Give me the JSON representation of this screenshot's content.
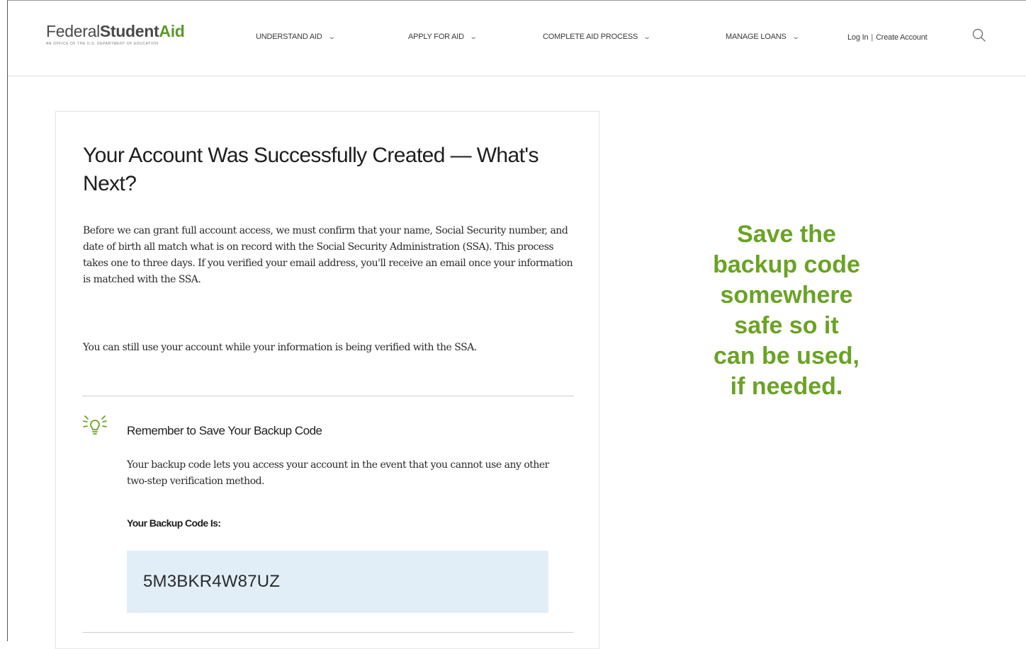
{
  "header": {
    "logo": {
      "part1": "Federal",
      "part2": "Student",
      "part3": "Aid",
      "tagline": "AN OFFICE of the U.S. DEPARTMENT of EDUCATION"
    },
    "nav": [
      {
        "label": "UNDERSTAND AID"
      },
      {
        "label": "APPLY FOR AID"
      },
      {
        "label": "COMPLETE AID PROCESS"
      },
      {
        "label": "MANAGE LOANS"
      }
    ],
    "login_label": "Log In",
    "separator": "|",
    "create_account_label": "Create Account",
    "search_icon": "search-icon"
  },
  "card": {
    "title": "Your Account Was Successfully Created — What's Next?",
    "paragraph1": "Before we can grant full account access, we must confirm that your name, Social Security number, and date of birth all match what is on record with the Social Security Administration (SSA). This process takes one to three days. If you verified your email address, you'll receive an email once your information is matched with the SSA.",
    "paragraph2": "You can still use your account while your information is being verified with the SSA.",
    "reminder": {
      "icon": "lightbulb-icon",
      "title": "Remember to Save Your Backup Code",
      "text": "Your backup code lets you access your account in the event that you cannot use any other two-step verification method.",
      "code_label": "Your Backup Code Is:",
      "code_value": "5M3BKR4W87UZ"
    }
  },
  "callout": {
    "lines": [
      "Save the",
      "backup code",
      "somewhere",
      "safe so it",
      "can be used,",
      "if needed."
    ],
    "color": "#6aa324"
  },
  "colors": {
    "brand_green": "#5a9a2a",
    "code_box_bg": "#e1eef7"
  }
}
